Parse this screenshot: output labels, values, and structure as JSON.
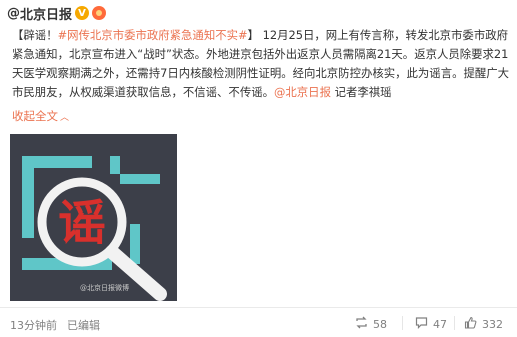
{
  "header": {
    "at_sign": "@",
    "author": "北京日报",
    "verify_icon": "V"
  },
  "post": {
    "open_bracket": "【",
    "lead": "辟谣！",
    "topic": "#网传北京市委市政府紧急通知不实#",
    "close_bracket": "】",
    "text": "12月25日，网上有传言称，转发北京市委市政府紧急通知，北京宣布进入“战时”状态。外地进京包括外出返京人员需隔离21天。返京人员除要求21天医学观察期满之外，还需持7日内核酸检测阴性证明。经向北京防控办核实，此为谣言。提醒广大市民朋友，从权威渠道获取信息，不信谣、不传谣。",
    "mention": "@北京日报",
    "author_note": " 记者李祺瑶"
  },
  "collapse": {
    "label": "收起全文",
    "icon": "chevron-up-icon"
  },
  "image": {
    "char": "谣",
    "watermark": "@北京日报微博"
  },
  "footer": {
    "time": "13分钟前",
    "edited": "已编辑",
    "repost_count": "58",
    "comment_count": "47",
    "like_count": "332"
  },
  "colors": {
    "link": "#eb7350",
    "image_bg": "#3c3f49",
    "image_accent": "#5fc6c8",
    "image_red": "#d9302c"
  }
}
